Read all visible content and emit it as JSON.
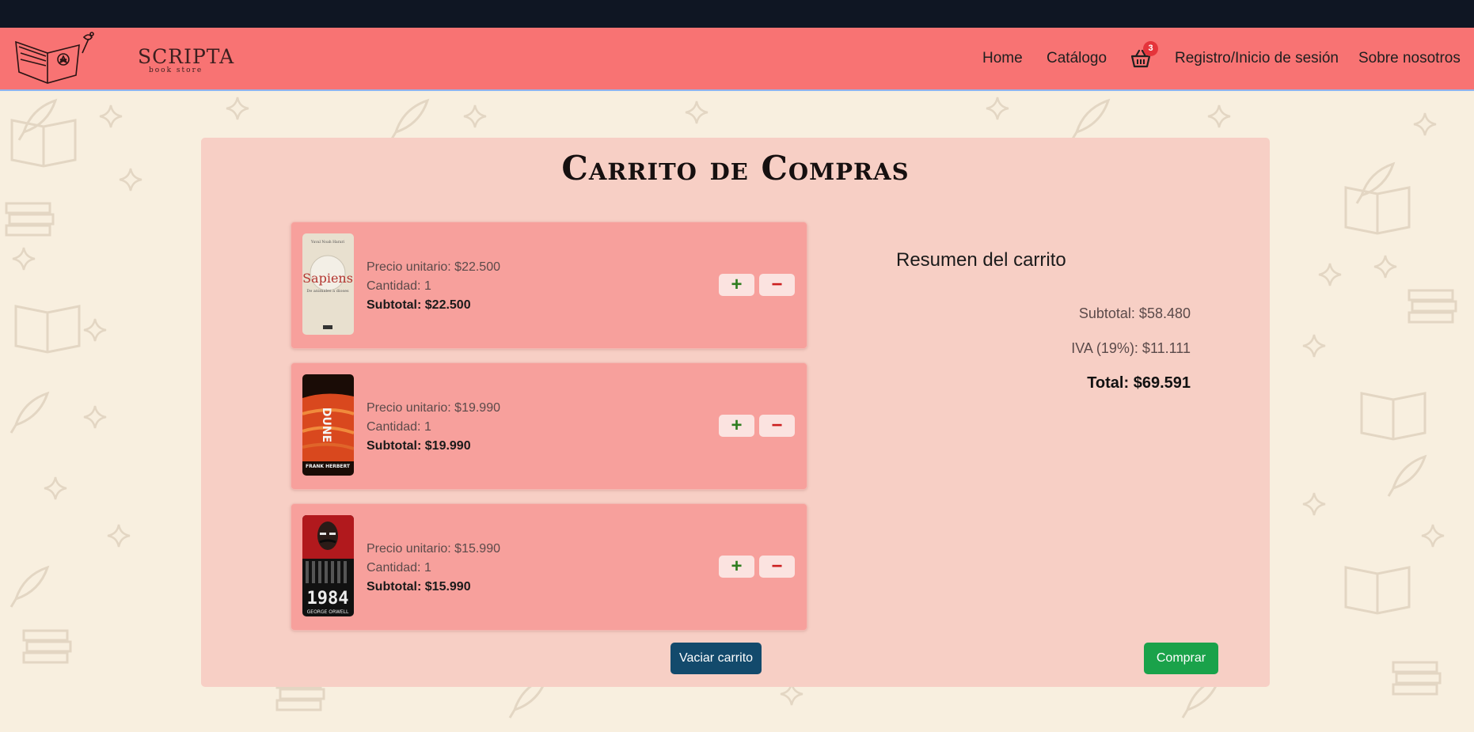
{
  "brand": {
    "name": "SCRIPTA",
    "tagline": "book store"
  },
  "nav": {
    "home": "Home",
    "catalog": "Catálogo",
    "cart_count": "3",
    "login": "Registro/Inicio de sesión",
    "about": "Sobre nosotros"
  },
  "page": {
    "title": "Carrito de Compras"
  },
  "cart": {
    "items": [
      {
        "cover": "Sapiens",
        "unit_price": "Precio unitario: $22.500",
        "quantity": "Cantidad: 1",
        "subtotal": "Subtotal: $22.500"
      },
      {
        "cover": "Dune",
        "unit_price": "Precio unitario: $19.990",
        "quantity": "Cantidad: 1",
        "subtotal": "Subtotal: $19.990"
      },
      {
        "cover": "1984",
        "unit_price": "Precio unitario: $15.990",
        "quantity": "Cantidad: 1",
        "subtotal": "Subtotal: $15.990"
      }
    ],
    "plus_label": "+",
    "minus_label": "−"
  },
  "summary": {
    "title": "Resumen del carrito",
    "subtotal": "Subtotal: $58.480",
    "iva": "IVA (19%): $11.111",
    "total": "Total: $69.591"
  },
  "actions": {
    "clear": "Vaciar carrito",
    "buy": "Comprar"
  },
  "covers": {
    "sapiens_author": "Yuval Noah Harari",
    "sapiens_title": "Sapiens",
    "sapiens_subtitle": "De animales a dioses",
    "dune_title": "DUNE",
    "dune_author": "FRANK HERBERT",
    "orwell_title": "1984",
    "orwell_author": "GEORGE ORWELL"
  },
  "colors": {
    "navbar": "#f87373",
    "topbar": "#0f1623",
    "background": "#f8efdf",
    "panel": "#f7cfc5",
    "card": "#f7a09c",
    "clear_button": "#134a6c",
    "buy_button": "#1aa24a",
    "badge": "#e5343b"
  }
}
